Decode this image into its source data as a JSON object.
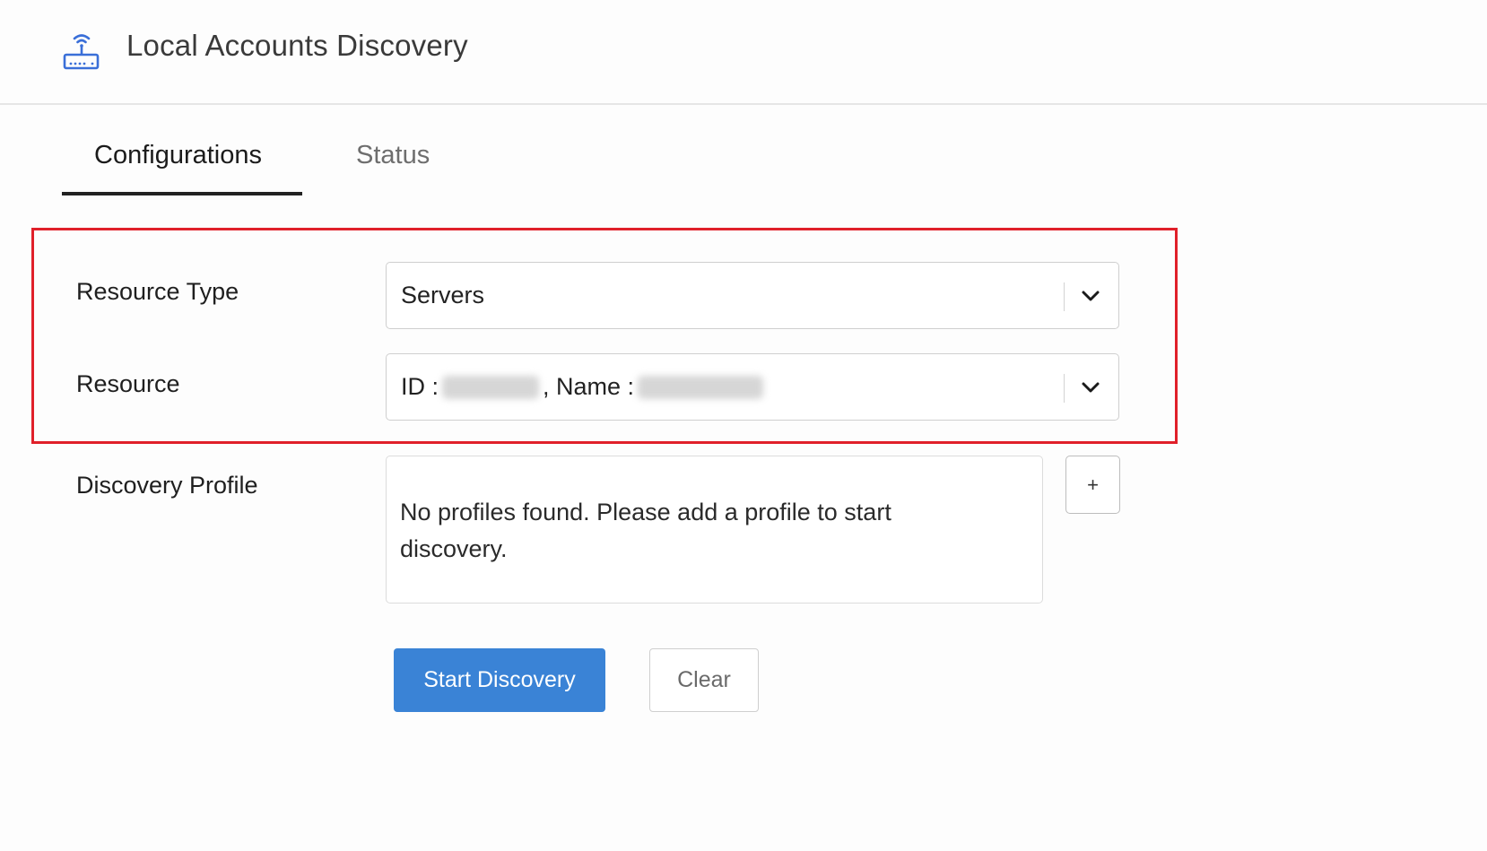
{
  "header": {
    "title": "Local Accounts Discovery",
    "icon": "router-icon",
    "accent_color": "#3a6fd8"
  },
  "tabs": [
    {
      "label": "Configurations",
      "active": true
    },
    {
      "label": "Status",
      "active": false
    }
  ],
  "form": {
    "resource_type": {
      "label": "Resource Type",
      "value": "Servers"
    },
    "resource": {
      "label": "Resource",
      "id_prefix": "ID :",
      "name_prefix": ", Name :"
    },
    "discovery_profile": {
      "label": "Discovery Profile",
      "empty_message": "No profiles found. Please add a profile to start discovery.",
      "add_label": "+"
    }
  },
  "actions": {
    "start_label": "Start Discovery",
    "clear_label": "Clear",
    "primary_color": "#3a83d6"
  },
  "highlight_color": "#e0202a"
}
